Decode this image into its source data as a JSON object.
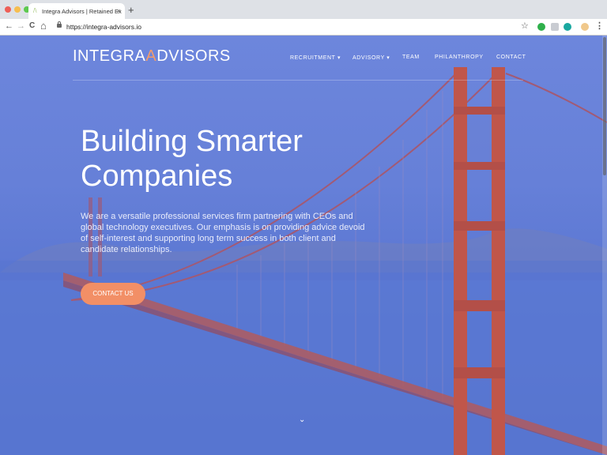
{
  "browser": {
    "tab_title": "Integra Advisors | Retained Ex",
    "tab_close": "×",
    "new_tab": "+",
    "url": "https://integra-advisors.io",
    "nav_back": "←",
    "nav_forward": "→",
    "nav_reload": "C",
    "nav_home": "⌂",
    "star_icon": "☆",
    "menu_dots": "⋮"
  },
  "site": {
    "logo_left": "INTEGRA",
    "logo_mid": "A",
    "logo_right": "DVISORS",
    "nav": {
      "recruitment": "RECRUITMENT ▾",
      "advisory": "ADVISORY ▾",
      "team": "TEAM",
      "philanthropy": "PHILANTHROPY",
      "contact": "CONTACT"
    },
    "hero": {
      "title_line1": "Building Smarter",
      "title_line2": "Companies",
      "body": "We are a versatile professional services firm partnering with CEOs and global technology executives. Our emphasis is on providing advice devoid of self-interest and supporting long term success in both client and candidate relationships.",
      "cta_label": "CONTACT US",
      "scroll_chevron": "⌄"
    }
  },
  "colors": {
    "overlay": "#6680d8",
    "accent": "#f28f66",
    "bridge": "#c0564a"
  }
}
